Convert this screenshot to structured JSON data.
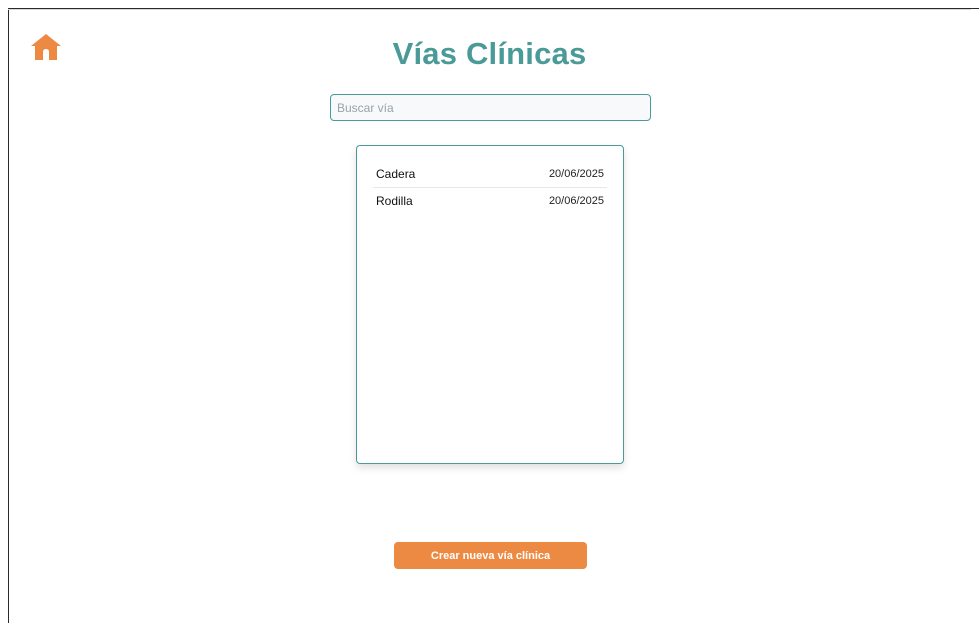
{
  "colors": {
    "teal": "#4a9a98",
    "orange": "#ec8a43"
  },
  "header": {
    "home_icon": "home-icon",
    "title": "Vías Clínicas"
  },
  "search": {
    "placeholder": "Buscar vía",
    "value": ""
  },
  "list": {
    "items": [
      {
        "name": "Cadera",
        "date": "20/06/2025"
      },
      {
        "name": "Rodilla",
        "date": "20/06/2025"
      }
    ]
  },
  "actions": {
    "create_label": "Crear nueva vía clínica"
  }
}
